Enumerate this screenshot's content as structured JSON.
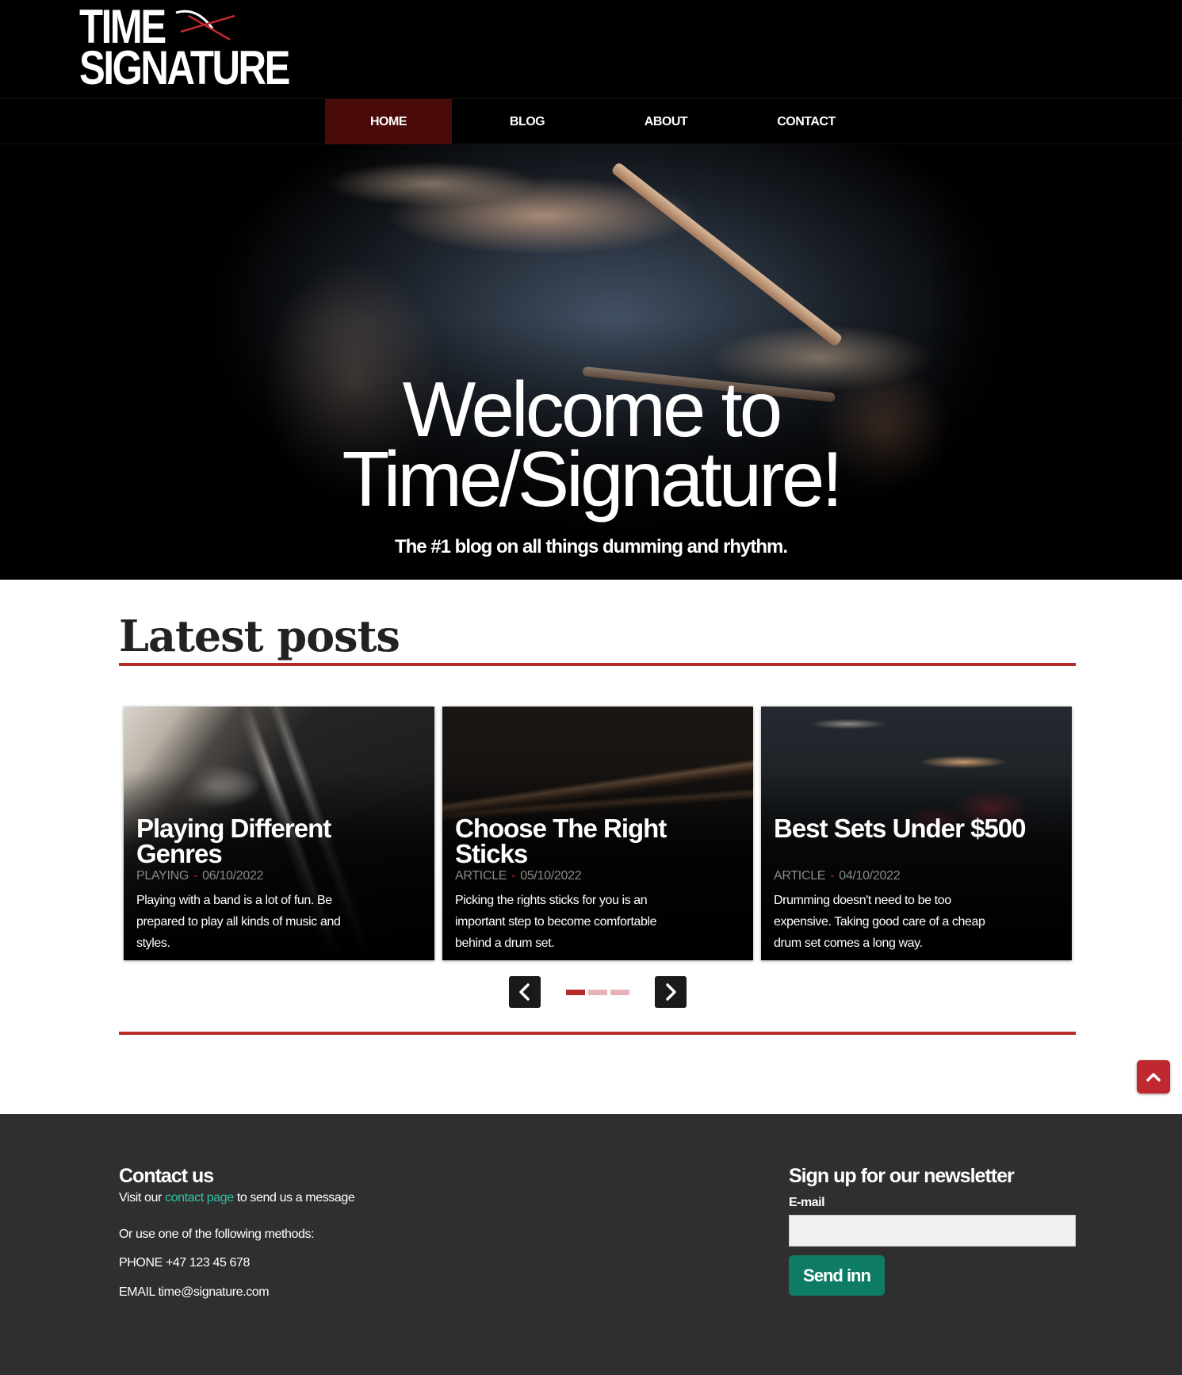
{
  "header": {
    "logo_line1": "TIME",
    "logo_line2": "SIGNATURE",
    "logo_accent": "#c0282f"
  },
  "nav": {
    "items": [
      {
        "label": "HOME",
        "active": true
      },
      {
        "label": "BLOG",
        "active": false
      },
      {
        "label": "ABOUT",
        "active": false
      },
      {
        "label": "CONTACT",
        "active": false
      }
    ],
    "active_color": "#4a0a0a"
  },
  "hero": {
    "title_line1": "Welcome to",
    "title_line2": "Time/Signature!",
    "subtitle": "The #1 blog on all things dumming and rhythm."
  },
  "latest": {
    "heading": "Latest posts",
    "accent": "#b82b2b",
    "posts": [
      {
        "title": "Playing Different Genres",
        "category": "PLAYING",
        "date": "06/10/2022",
        "excerpt": "Playing with a band is a lot of fun. Be prepared to play all kinds of music and styles."
      },
      {
        "title": "Choose The Right Sticks",
        "category": "ARTICLE",
        "date": "05/10/2022",
        "excerpt": "Picking the rights sticks for you is an important step to become comfortable behind a drum set."
      },
      {
        "title": "Best Sets Under $500",
        "category": "ARTICLE",
        "date": "04/10/2022",
        "excerpt": "Drumming doesn't need to be too expensive. Taking good care of a cheap drum set comes a long way."
      }
    ],
    "carousel": {
      "prev_icon": "chevron-left-icon",
      "next_icon": "chevron-right-icon",
      "dots": 3,
      "active_dot": 0
    }
  },
  "scroll_top_icon": "chevron-up-icon",
  "footer": {
    "contact_heading": "Contact us",
    "visit_prefix": "Visit our",
    "visit_link": "contact page",
    "visit_suffix": "to send us a message",
    "methods": "Or use one of the following methods:",
    "phone": "PHONE +47 123 45 678",
    "email": "EMAIL time@signature.com",
    "newsletter_heading": "Sign up for our newsletter",
    "email_label": "E-mail",
    "email_value": "",
    "send_label": "Send inn",
    "link_color": "#2fc3a6",
    "button_color": "#0e7c64"
  }
}
